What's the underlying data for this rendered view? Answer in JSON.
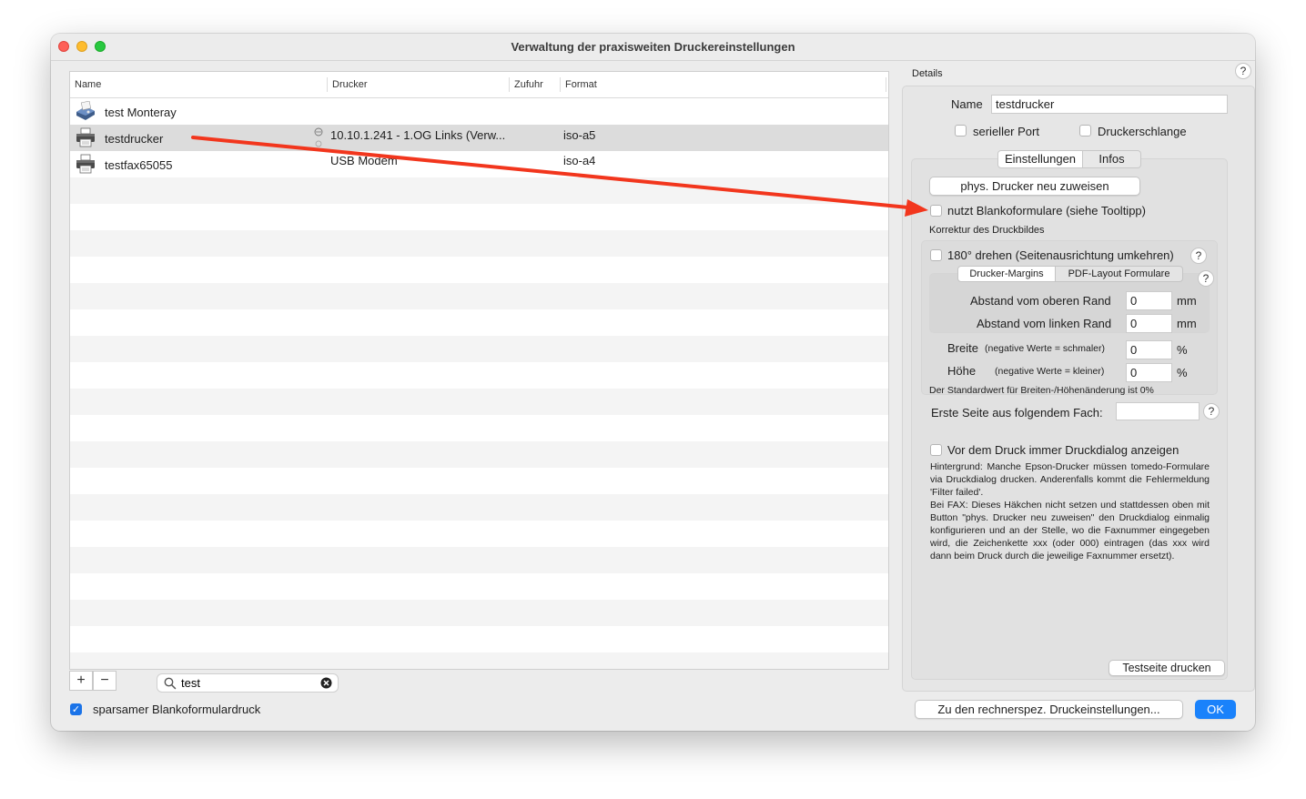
{
  "window": {
    "title": "Verwaltung der praxisweiten Druckereinstellungen"
  },
  "table": {
    "columns": [
      "Name",
      "Drucker",
      "Zufuhr",
      "Format"
    ],
    "rows": [
      {
        "name": "test Monteray",
        "printer": "",
        "feed": "",
        "format": "",
        "icon": "fax-printer-icon"
      },
      {
        "name": "testdrucker",
        "printer": "10.10.1.241 - 1.OG Links (Verw...",
        "feed": "",
        "format": "iso-a5",
        "icon": "printer-icon",
        "selected": true
      },
      {
        "name": "testfax65055",
        "printer": "USB Modem",
        "feed": "",
        "format": "iso-a4",
        "icon": "printer-icon"
      }
    ]
  },
  "bottom_left": {
    "add": "+",
    "remove": "−",
    "search_value": "test",
    "checkbox_label": "sparsamer Blankoformulardruck",
    "checkbox_checked": true
  },
  "details": {
    "header": "Details",
    "name_label": "Name",
    "name_value": "testdrucker",
    "serial_port": "serieller Port",
    "printer_queue": "Druckerschlange",
    "tabs": [
      "Einstellungen",
      "Infos"
    ],
    "reassign_button": "phys. Drucker neu zuweisen",
    "blank_forms": "nutzt Blankoformulare (siehe Tooltipp)",
    "correction_header": "Korrektur des Druckbildes",
    "rotate": "180° drehen (Seitenausrichtung umkehren)",
    "subtabs": [
      "Drucker-Margins",
      "PDF-Layout Formulare"
    ],
    "top_margin_label": "Abstand vom oberen Rand",
    "top_margin_value": "0",
    "left_margin_label": "Abstand vom linken Rand",
    "left_margin_value": "0",
    "unit_mm": "mm",
    "width_label": "Breite",
    "width_hint": "(negative Werte = schmaler)",
    "width_value": "0",
    "height_label": "Höhe",
    "height_hint": "(negative Werte = kleiner)",
    "height_value": "0",
    "unit_pct": "%",
    "default_note": "Der Standardwert für Breiten-/Höhenänderung ist 0%",
    "first_page_label": "Erste Seite aus folgendem Fach:",
    "first_page_value": "",
    "print_dialog": "Vor dem Druck immer Druckdialog anzeigen",
    "description": "Hintergrund: Manche Epson-Drucker müssen tomedo-Formulare via Druckdialog drucken. Anderenfalls kommt die Fehlermeldung 'Filter failed'.\nBei FAX: Dieses Häkchen nicht setzen und stattdessen oben mit Button \"phys. Drucker neu zuweisen\" den Druckdialog einmalig konfigurieren und an der Stelle, wo die Faxnummer eingegeben wird, die Zeichenkette xxx (oder 000) eintragen (das xxx wird dann beim Druck durch die jeweilige Faxnummer ersetzt).",
    "test_page_button": "Testseite drucken"
  },
  "footer": {
    "computer_settings_button": "Zu den rechnerspez. Druckeinstellungen...",
    "ok_button": "OK"
  },
  "help_glyph": "?",
  "colors": {
    "accent": "#1a82fb",
    "arrow": "#f2361d"
  }
}
